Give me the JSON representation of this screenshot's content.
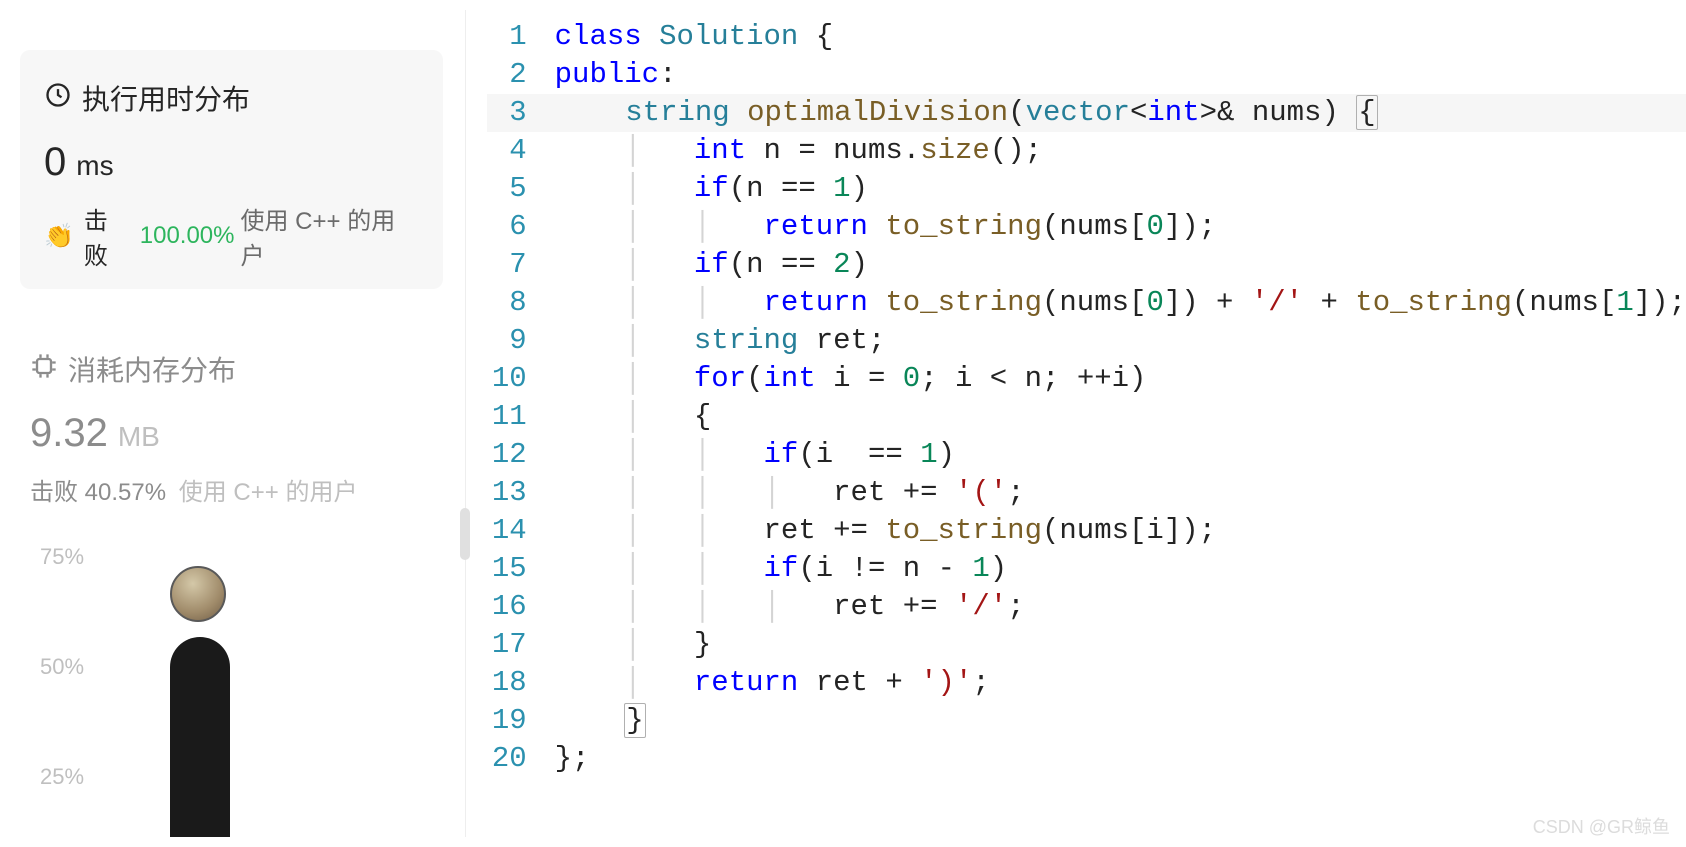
{
  "stats": {
    "runtime": {
      "title": "执行用时分布",
      "value": "0",
      "unit": "ms",
      "beat_prefix": "击败",
      "beat_pct": "100.00%",
      "beat_suffix": "使用 C++ 的用户"
    },
    "memory": {
      "title": "消耗内存分布",
      "value": "9.32",
      "unit": "MB",
      "beat_prefix": "击败",
      "beat_pct": "40.57%",
      "beat_suffix": "使用 C++ 的用户"
    }
  },
  "chart_data": {
    "type": "bar",
    "yticks": [
      "75%",
      "50%",
      "25%"
    ],
    "categories": [
      "bucket_0"
    ],
    "values": [
      60
    ],
    "ylim": [
      0,
      100
    ]
  },
  "code": {
    "lines": [
      {
        "n": "1",
        "tokens": [
          [
            "class ",
            "kw"
          ],
          [
            "Solution ",
            "usert"
          ],
          [
            "{",
            "pun"
          ]
        ]
      },
      {
        "n": "2",
        "tokens": [
          [
            "public",
            "kw"
          ],
          [
            ":",
            "pun"
          ]
        ]
      },
      {
        "n": "3",
        "hl": true,
        "tokens": [
          [
            "    ",
            ""
          ],
          [
            "string ",
            "usert"
          ],
          [
            "optimalDivision",
            "func"
          ],
          [
            "(",
            "pun"
          ],
          [
            "vector",
            "usert"
          ],
          [
            "<",
            "pun"
          ],
          [
            "int",
            "type"
          ],
          [
            ">& ",
            "pun"
          ],
          [
            "nums",
            "pun"
          ],
          [
            ") ",
            "pun"
          ],
          [
            "{",
            "brace"
          ]
        ]
      },
      {
        "n": "4",
        "tokens": [
          [
            "    ",
            ""
          ],
          [
            "│",
            "guide"
          ],
          [
            "   ",
            ""
          ],
          [
            "int ",
            "type"
          ],
          [
            "n ",
            "pun"
          ],
          [
            "= ",
            "pun"
          ],
          [
            "nums",
            "pun"
          ],
          [
            ".",
            "pun"
          ],
          [
            "size",
            "func"
          ],
          [
            "();",
            "pun"
          ]
        ]
      },
      {
        "n": "5",
        "tokens": [
          [
            "    ",
            ""
          ],
          [
            "│",
            "guide"
          ],
          [
            "   ",
            ""
          ],
          [
            "if",
            "kw"
          ],
          [
            "(",
            "pun"
          ],
          [
            "n ",
            "pun"
          ],
          [
            "== ",
            "pun"
          ],
          [
            "1",
            "num"
          ],
          [
            ")",
            "pun"
          ]
        ]
      },
      {
        "n": "6",
        "tokens": [
          [
            "    ",
            ""
          ],
          [
            "│",
            "guide"
          ],
          [
            "   ",
            ""
          ],
          [
            "│",
            "guide"
          ],
          [
            "   ",
            ""
          ],
          [
            "return ",
            "kw"
          ],
          [
            "to_string",
            "func"
          ],
          [
            "(",
            "pun"
          ],
          [
            "nums",
            "pun"
          ],
          [
            "[",
            "pun"
          ],
          [
            "0",
            "num"
          ],
          [
            "]);",
            "pun"
          ]
        ]
      },
      {
        "n": "7",
        "tokens": [
          [
            "    ",
            ""
          ],
          [
            "│",
            "guide"
          ],
          [
            "   ",
            ""
          ],
          [
            "if",
            "kw"
          ],
          [
            "(",
            "pun"
          ],
          [
            "n ",
            "pun"
          ],
          [
            "== ",
            "pun"
          ],
          [
            "2",
            "num"
          ],
          [
            ")",
            "pun"
          ]
        ]
      },
      {
        "n": "8",
        "tokens": [
          [
            "    ",
            ""
          ],
          [
            "│",
            "guide"
          ],
          [
            "   ",
            ""
          ],
          [
            "│",
            "guide"
          ],
          [
            "   ",
            ""
          ],
          [
            "return ",
            "kw"
          ],
          [
            "to_string",
            "func"
          ],
          [
            "(",
            "pun"
          ],
          [
            "nums",
            "pun"
          ],
          [
            "[",
            "pun"
          ],
          [
            "0",
            "num"
          ],
          [
            "]) + ",
            "pun"
          ],
          [
            "'/'",
            "str"
          ],
          [
            " + ",
            "pun"
          ],
          [
            "to_string",
            "func"
          ],
          [
            "(",
            "pun"
          ],
          [
            "nums",
            "pun"
          ],
          [
            "[",
            "pun"
          ],
          [
            "1",
            "num"
          ],
          [
            "]);",
            "pun"
          ]
        ]
      },
      {
        "n": "9",
        "tokens": [
          [
            "    ",
            ""
          ],
          [
            "│",
            "guide"
          ],
          [
            "   ",
            ""
          ],
          [
            "string ",
            "usert"
          ],
          [
            "ret;",
            "pun"
          ]
        ]
      },
      {
        "n": "10",
        "tokens": [
          [
            "    ",
            ""
          ],
          [
            "│",
            "guide"
          ],
          [
            "   ",
            ""
          ],
          [
            "for",
            "kw"
          ],
          [
            "(",
            "pun"
          ],
          [
            "int ",
            "type"
          ],
          [
            "i ",
            "pun"
          ],
          [
            "= ",
            "pun"
          ],
          [
            "0",
            "num"
          ],
          [
            "; i < n; ++i)",
            "pun"
          ]
        ]
      },
      {
        "n": "11",
        "tokens": [
          [
            "    ",
            ""
          ],
          [
            "│",
            "guide"
          ],
          [
            "   {",
            "pun"
          ]
        ]
      },
      {
        "n": "12",
        "tokens": [
          [
            "    ",
            ""
          ],
          [
            "│",
            "guide"
          ],
          [
            "   ",
            ""
          ],
          [
            "│",
            "guide"
          ],
          [
            "   ",
            ""
          ],
          [
            "if",
            "kw"
          ],
          [
            "(",
            "pun"
          ],
          [
            "i  ",
            "pun"
          ],
          [
            "== ",
            "pun"
          ],
          [
            "1",
            "num"
          ],
          [
            ")",
            "pun"
          ]
        ]
      },
      {
        "n": "13",
        "tokens": [
          [
            "    ",
            ""
          ],
          [
            "│",
            "guide"
          ],
          [
            "   ",
            ""
          ],
          [
            "│",
            "guide"
          ],
          [
            "   ",
            ""
          ],
          [
            "│",
            "guide"
          ],
          [
            "   ret += ",
            "pun"
          ],
          [
            "'('",
            "str"
          ],
          [
            ";",
            "pun"
          ]
        ]
      },
      {
        "n": "14",
        "tokens": [
          [
            "    ",
            ""
          ],
          [
            "│",
            "guide"
          ],
          [
            "   ",
            ""
          ],
          [
            "│",
            "guide"
          ],
          [
            "   ret += ",
            "pun"
          ],
          [
            "to_string",
            "func"
          ],
          [
            "(",
            "pun"
          ],
          [
            "nums",
            "pun"
          ],
          [
            "[i]);",
            "pun"
          ]
        ]
      },
      {
        "n": "15",
        "tokens": [
          [
            "    ",
            ""
          ],
          [
            "│",
            "guide"
          ],
          [
            "   ",
            ""
          ],
          [
            "│",
            "guide"
          ],
          [
            "   ",
            ""
          ],
          [
            "if",
            "kw"
          ],
          [
            "(",
            "pun"
          ],
          [
            "i ",
            "pun"
          ],
          [
            "!= n - ",
            "pun"
          ],
          [
            "1",
            "num"
          ],
          [
            ")",
            "pun"
          ]
        ]
      },
      {
        "n": "16",
        "tokens": [
          [
            "    ",
            ""
          ],
          [
            "│",
            "guide"
          ],
          [
            "   ",
            ""
          ],
          [
            "│",
            "guide"
          ],
          [
            "   ",
            ""
          ],
          [
            "│",
            "guide"
          ],
          [
            "   ret += ",
            "pun"
          ],
          [
            "'/'",
            "str"
          ],
          [
            ";",
            "pun"
          ]
        ]
      },
      {
        "n": "17",
        "tokens": [
          [
            "    ",
            ""
          ],
          [
            "│",
            "guide"
          ],
          [
            "   }",
            "pun"
          ]
        ]
      },
      {
        "n": "18",
        "tokens": [
          [
            "    ",
            ""
          ],
          [
            "│",
            "guide"
          ],
          [
            "   ",
            ""
          ],
          [
            "return ",
            "kw"
          ],
          [
            "ret + ",
            "pun"
          ],
          [
            "')'",
            "str"
          ],
          [
            ";",
            "pun"
          ]
        ]
      },
      {
        "n": "19",
        "tokens": [
          [
            "    ",
            ""
          ],
          [
            "}",
            "brace"
          ]
        ]
      },
      {
        "n": "20",
        "tokens": [
          [
            "};",
            "pun"
          ]
        ]
      }
    ]
  },
  "watermark": "CSDN @GR鲸鱼"
}
